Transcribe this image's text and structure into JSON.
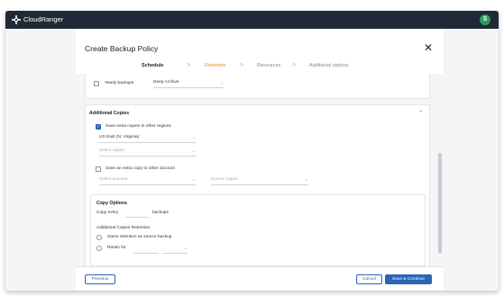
{
  "app": {
    "name": "CloudRanger",
    "user_initial": "S"
  },
  "dialog": {
    "title": "Create Backup Policy",
    "steps": [
      "Schedule",
      "Retention",
      "Resources",
      "Additional options"
    ],
    "step_separator": ">"
  },
  "yearly": {
    "label": "Yearly backups",
    "storage_class": "Deep Archive"
  },
  "additional_copies": {
    "header": "Additional Copies",
    "region_copy": {
      "label": "Save extra copies to other regions",
      "selected_region": "US East (N. Virginia)",
      "select_placeholder": "Select region"
    },
    "account_copy": {
      "label": "Save an extra copy to other account",
      "account_placeholder": "Select account",
      "region_placeholder": "Source region"
    },
    "copy_options": {
      "title": "Copy Options",
      "copy_every": "Copy every",
      "backups": "backups",
      "retention_title": "Additional Copies Retention",
      "same_retention": "Same retention as source backup",
      "retain_for": "Retain for"
    }
  },
  "footer": {
    "previous": "Previous",
    "cancel": "Cancel",
    "save": "Save & Continue"
  },
  "colors": {
    "topbar": "#1f2a36",
    "primary": "#2a64b8",
    "active_step": "#e8922c",
    "avatar": "#2f9a5a"
  },
  "icons": {
    "logo": "cloudranger-logo-icon",
    "close": "close-icon",
    "chevron": "chevron-down-icon",
    "collapse": "chevron-up-icon"
  }
}
